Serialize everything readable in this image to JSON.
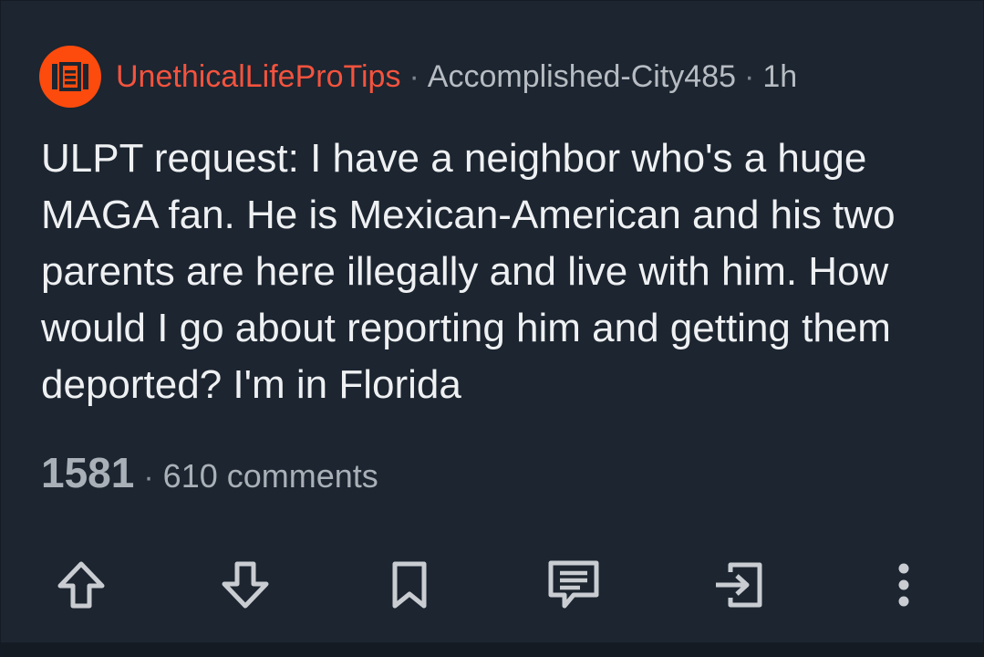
{
  "post": {
    "subreddit": "UnethicalLifeProTips",
    "separator": "·",
    "author": "Accomplished-City485",
    "time": "1h",
    "title": "ULPT request: I have a neighbor who's a huge MAGA fan. He is Mexican-American and his two parents are here illegally and live with him. How would I go about reporting him and getting them deported? I'm in Florida",
    "score": "1581",
    "comments": "610 comments"
  },
  "actions": [
    {
      "icon": "upvote-icon"
    },
    {
      "icon": "downvote-icon"
    },
    {
      "icon": "bookmark-icon"
    },
    {
      "icon": "comment-icon"
    },
    {
      "icon": "share-icon"
    },
    {
      "icon": "more-options-icon"
    }
  ],
  "colors": {
    "background": "#1c2530",
    "subreddit": "#f4533e",
    "avatar": "#fc4b0d",
    "title_text": "#eef0f2",
    "secondary_text": "#b7bcc2",
    "icon": "#c9cdd2"
  }
}
